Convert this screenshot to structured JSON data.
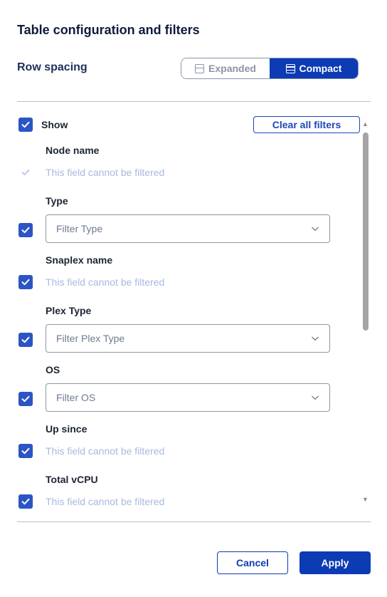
{
  "dialog": {
    "title": "Table configuration and filters"
  },
  "row_spacing": {
    "label": "Row spacing",
    "options": [
      {
        "label": "Expanded",
        "selected": false,
        "icon": "expanded-rows-icon"
      },
      {
        "label": "Compact",
        "selected": true,
        "icon": "compact-rows-icon"
      }
    ]
  },
  "filters": {
    "show_label": "Show",
    "show_checked": true,
    "clear_all_label": "Clear all filters",
    "fields": [
      {
        "name": "Node name",
        "checked": true,
        "disabled": true,
        "filterable": false,
        "note": "This field cannot be filtered"
      },
      {
        "name": "Type",
        "checked": true,
        "filterable": true,
        "placeholder": "Filter Type"
      },
      {
        "name": "Snaplex name",
        "checked": true,
        "filterable": false,
        "note": "This field cannot be filtered"
      },
      {
        "name": "Plex Type",
        "checked": true,
        "filterable": true,
        "placeholder": "Filter Plex Type"
      },
      {
        "name": "OS",
        "checked": true,
        "filterable": true,
        "placeholder": "Filter OS"
      },
      {
        "name": "Up since",
        "checked": true,
        "filterable": false,
        "note": "This field cannot be filtered"
      },
      {
        "name": "Total vCPU",
        "checked": true,
        "filterable": false,
        "note": "This field cannot be filtered"
      }
    ]
  },
  "footer": {
    "cancel_label": "Cancel",
    "apply_label": "Apply"
  },
  "colors": {
    "primary": "#0c3bb4",
    "checkbox": "#2c55c4",
    "disabled_text": "#a7b9e0"
  }
}
